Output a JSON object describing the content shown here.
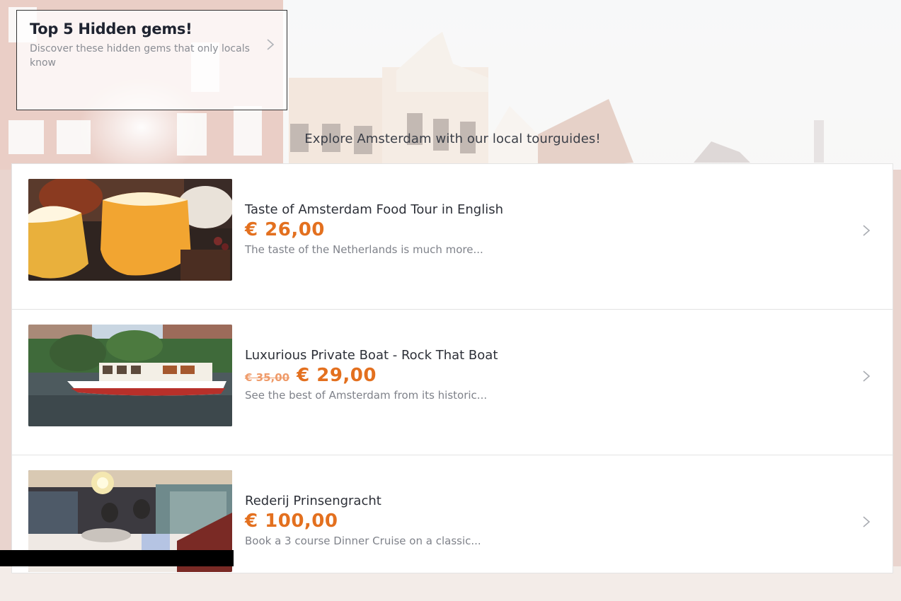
{
  "hidden_gems": {
    "title": "Top 5 Hidden gems!",
    "subtitle": "Discover these hidden gems that only locals know"
  },
  "explore_heading": "Explore Amsterdam with our local tourguides!",
  "tours": [
    {
      "title": "Taste of Amsterdam Food Tour in English",
      "old_price": "",
      "price": "€ 26,00",
      "description": "The taste of the Netherlands is much more..."
    },
    {
      "title": "Luxurious Private Boat - Rock That Boat",
      "old_price": "€ 35,00",
      "price": "€ 29,00",
      "description": "See the best of Amsterdam from its historic..."
    },
    {
      "title": "Rederij Prinsengracht",
      "old_price": "",
      "price": "€ 100,00",
      "description": "Book a 3 course Dinner Cruise on a classic..."
    }
  ],
  "colors": {
    "price": "#e3701f",
    "old_price": "#ef9b6a",
    "title_text": "#2d3038",
    "muted_text": "#7f828a"
  },
  "icons": {
    "chevron": "chevron-right-icon"
  }
}
